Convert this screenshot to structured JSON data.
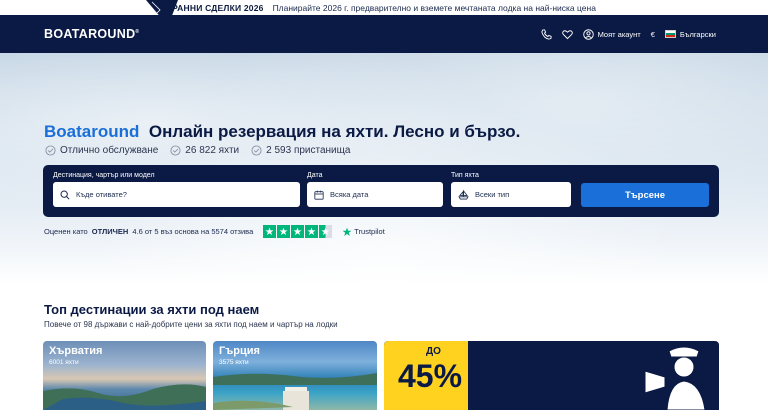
{
  "promo_banner": {
    "title": "РАННИ СДЕЛКИ 2026",
    "text": "Планирайте 2026 г. предварително и вземете мечтаната лодка на най-ниска цена"
  },
  "header": {
    "logo": "BOATAROUND",
    "account_label": "Моят акаунт",
    "currency": "€",
    "language": "Български"
  },
  "hero": {
    "brand": "Boataround",
    "headline": "Онлайн резервация на яхти. Лесно и бързо.",
    "features": [
      "Отлично обслужване",
      "26 822 яхти",
      "2 593 пристанища"
    ]
  },
  "search": {
    "destination_label": "Дестинация, чартър или модел",
    "destination_placeholder": "Къде отивате?",
    "date_label": "Дата",
    "date_value": "Всяка дата",
    "type_label": "Тип яхта",
    "type_value": "Всеки тип",
    "button": "Търсене"
  },
  "rating": {
    "prefix": "Оценен като",
    "word": "ОТЛИЧЕН",
    "suffix": "4.6 от 5 въз основа на 5574 отзива",
    "stars_value": 4.5,
    "trustpilot": "Trustpilot"
  },
  "destinations": {
    "title": "Топ дестинации за яхти под наем",
    "subtitle": "Повече от 98 държави с най-добрите цени за яхти под наем и чартър на лодки",
    "cards": [
      {
        "name": "Хърватия",
        "count": "6001 яхти"
      },
      {
        "name": "Гърция",
        "count": "3575 яхти"
      }
    ],
    "promo": {
      "prefix": "ДО",
      "value": "45%"
    }
  },
  "colors": {
    "navy": "#0b1a44",
    "accent_blue": "#1a6fd8",
    "promo_yellow": "#ffd21f",
    "trustpilot_green": "#00b67a"
  }
}
